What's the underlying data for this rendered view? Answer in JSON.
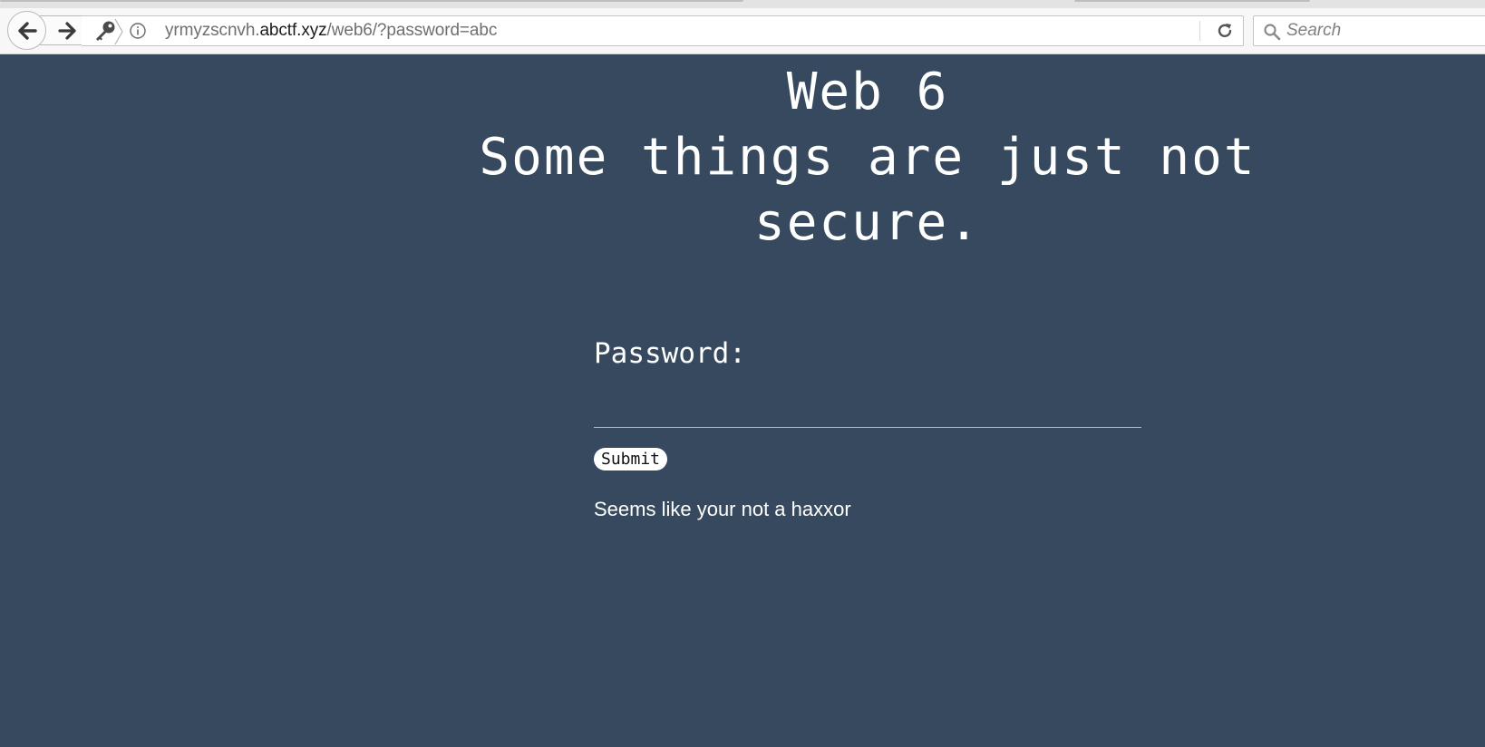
{
  "browser": {
    "url": {
      "subdomain": "yrmyzscnvh.",
      "domain": "abctf.xyz",
      "path": "/web6/?password=abc"
    },
    "search_placeholder": "Search",
    "icons": {
      "back": "arrow-left-icon",
      "forward": "arrow-right-icon",
      "identity": "key-icon",
      "info": "info-icon",
      "reload": "reload-icon",
      "search": "magnifier-icon"
    }
  },
  "page": {
    "title_line1": "Web 6",
    "title_line2": "Some things are just not secure.",
    "password_label": "Password:",
    "password_value": "",
    "submit_label": "Submit",
    "message": "Seems like your not a haxxor",
    "colors": {
      "background": "#36495e",
      "text": "#ffffff"
    }
  }
}
